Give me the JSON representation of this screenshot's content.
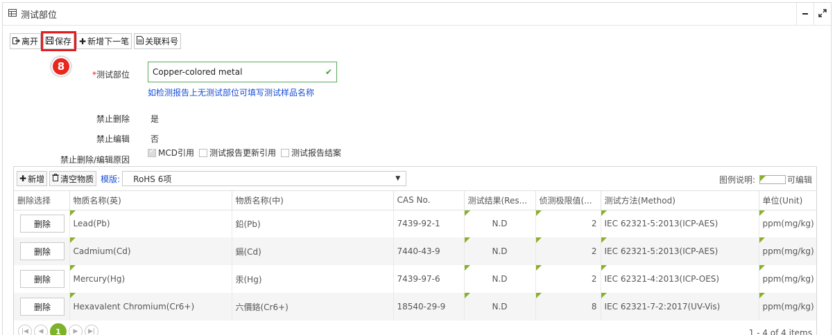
{
  "panel": {
    "title": "测试部位",
    "minimize_icon": "minus-icon",
    "expand_icon": "expand-icon"
  },
  "toolbar": {
    "leave_label": "离开",
    "save_label": "保存",
    "add_next_label": "新增下一笔",
    "link_part_label": "关联料号"
  },
  "step_badge": "8",
  "form": {
    "part_label": "测试部位",
    "part_value": "Copper-colored metal",
    "part_hint": "如检测报告上无测试部位可填写测试样品名称",
    "no_delete_label": "禁止删除",
    "no_delete_value": "是",
    "no_edit_label": "禁止编辑",
    "no_edit_value": "否",
    "reason_label": "禁止删除/编辑原因",
    "reasons": [
      {
        "label": "MCD引用",
        "checked": true
      },
      {
        "label": "测试报告更新引用",
        "checked": false
      },
      {
        "label": "测试报告结案",
        "checked": false
      }
    ]
  },
  "grid": {
    "add_label": "新增",
    "clear_label": "清空物质",
    "template_label": "模版:",
    "template_value": "RoHS 6项",
    "legend_label": "图例说明:",
    "legend_editable": "可编辑",
    "columns": [
      "删除选择",
      "物质名称(英)",
      "物质名称(中)",
      "CAS No.",
      "测试结果(Res...",
      "侦测极限值(...",
      "测试方法(Method)",
      "单位(Unit)"
    ],
    "delete_label": "删除",
    "rows": [
      {
        "en": "Lead(Pb)",
        "cn": "鉛(Pb)",
        "cas": "7439-92-1",
        "result": "N.D",
        "limit": "2",
        "method": "IEC 62321-5:2013(ICP-AES)",
        "unit": "ppm(mg/kg)"
      },
      {
        "en": "Cadmium(Cd)",
        "cn": "鎘(Cd)",
        "cas": "7440-43-9",
        "result": "N.D",
        "limit": "2",
        "method": "IEC 62321-5:2013(ICP-AES)",
        "unit": "ppm(mg/kg)"
      },
      {
        "en": "Mercury(Hg)",
        "cn": "汞(Hg)",
        "cas": "7439-97-6",
        "result": "N.D",
        "limit": "2",
        "method": "IEC 62321-4:2013(ICP-OES)",
        "unit": "ppm(mg/kg)"
      },
      {
        "en": "Hexavalent Chromium(Cr6+)",
        "cn": "六價鉻(Cr6+)",
        "cas": "18540-29-9",
        "result": "N.D",
        "limit": "8",
        "method": "IEC 62321-7-2:2017(UV-Vis)",
        "unit": "ppm(mg/kg)"
      }
    ],
    "current_page": "1",
    "pager_info": "1 - 4 of 4 items"
  }
}
